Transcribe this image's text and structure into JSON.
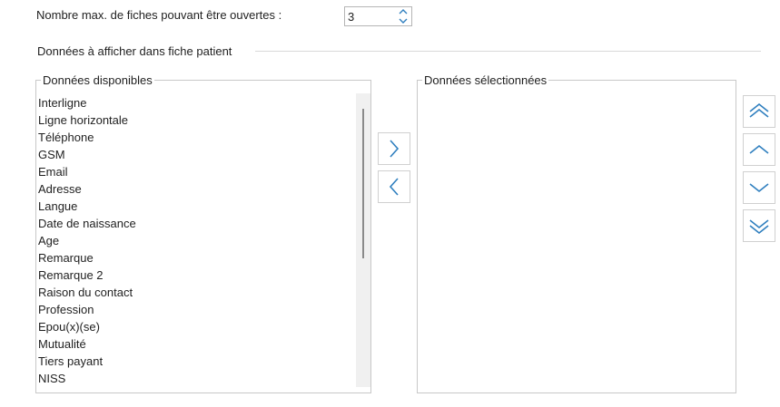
{
  "settings": {
    "max_records_label": "Nombre max. de fiches pouvant être ouvertes :",
    "max_records_value": "3"
  },
  "section": {
    "title": "Données à afficher dans fiche patient"
  },
  "available": {
    "title": "Données disponibles",
    "items": [
      "Interligne",
      "Ligne horizontale",
      "Téléphone",
      "GSM",
      "Email",
      "Adresse",
      "Langue",
      "Date de naissance",
      "Age",
      "Remarque",
      "Remarque 2",
      "Raison du contact",
      "Profession",
      "Epou(x)(se)",
      "Mutualité",
      "Tiers payant",
      "NISS"
    ]
  },
  "selected": {
    "title": "Données sélectionnées",
    "items": []
  },
  "icons": {
    "add": "chevron-right-icon",
    "remove": "chevron-left-icon",
    "top": "double-chevron-up-icon",
    "up": "chevron-up-icon",
    "down": "chevron-down-icon",
    "bottom": "double-chevron-down-icon"
  },
  "colors": {
    "accent": "#2f7fbf",
    "border": "#c8c8c8"
  }
}
